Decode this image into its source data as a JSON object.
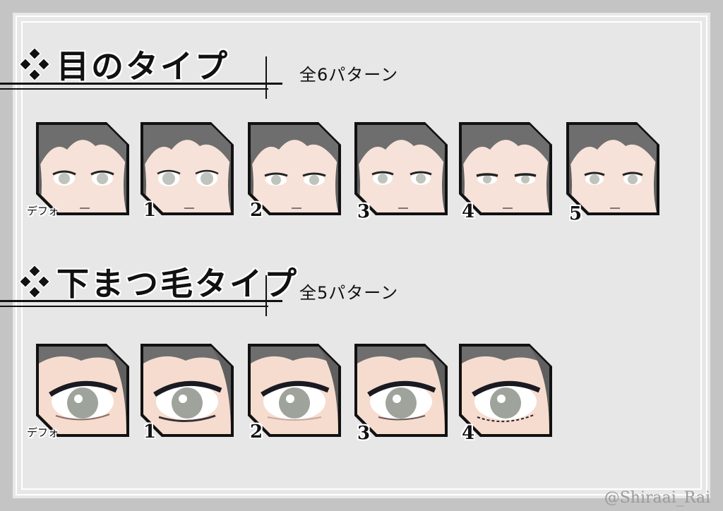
{
  "section1": {
    "title": "目のタイプ",
    "subtitle": "全6パターン",
    "labels": [
      "デフォ",
      "1",
      "2",
      "3",
      "4",
      "5"
    ]
  },
  "section2": {
    "title": "下まつ毛タイプ",
    "subtitle": "全5パターン",
    "labels": [
      "デフォ",
      "1",
      "2",
      "3",
      "4"
    ]
  },
  "watermark": "@Shiraai_Rai",
  "colors": {
    "background": "#c4c4c4",
    "sheet": "#e7e7e7",
    "hair": "#6e6e6e",
    "skin": "#f6e2d8",
    "eye": "#bfc3bd"
  }
}
